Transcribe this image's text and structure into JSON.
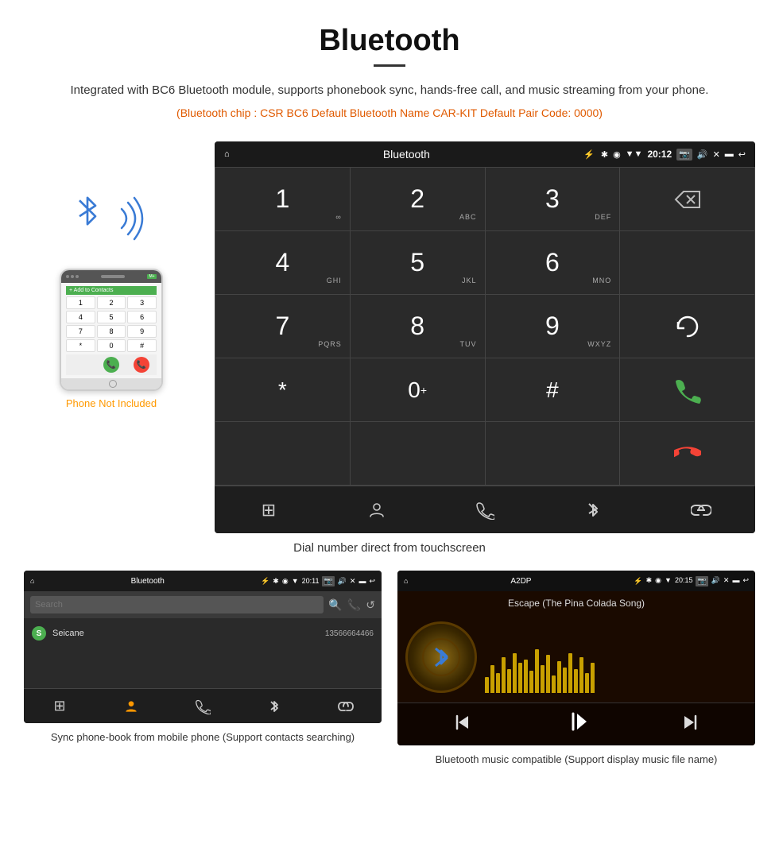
{
  "header": {
    "title": "Bluetooth",
    "description": "Integrated with BC6 Bluetooth module, supports phonebook sync, hands-free call, and music streaming from your phone.",
    "specs": "(Bluetooth chip : CSR BC6    Default Bluetooth Name CAR-KIT    Default Pair Code: 0000)"
  },
  "phone_label": "Phone Not Included",
  "dialer": {
    "title": "Bluetooth",
    "status": {
      "home_icon": "⌂",
      "usb_icon": "⚡",
      "bt_icon": "✱",
      "location_icon": "◉",
      "signal_icon": "▼",
      "time": "20:12",
      "camera_icon": "📷",
      "volume_icon": "🔊",
      "close_icon": "✕",
      "window_icon": "▬",
      "back_icon": "↩"
    },
    "keys": [
      {
        "label": "1",
        "sub": "∞"
      },
      {
        "label": "2",
        "sub": "ABC"
      },
      {
        "label": "3",
        "sub": "DEF"
      },
      {
        "label": "⌫",
        "type": "backspace"
      },
      {
        "label": "4",
        "sub": "GHI"
      },
      {
        "label": "5",
        "sub": "JKL"
      },
      {
        "label": "6",
        "sub": "MNO"
      },
      {
        "label": "",
        "type": "empty"
      },
      {
        "label": "7",
        "sub": "PQRS"
      },
      {
        "label": "8",
        "sub": "TUV"
      },
      {
        "label": "9",
        "sub": "WXYZ"
      },
      {
        "label": "↺",
        "type": "refresh"
      },
      {
        "label": "*",
        "type": "star"
      },
      {
        "label": "0⁺",
        "type": "zero"
      },
      {
        "label": "#",
        "type": "hash"
      },
      {
        "label": "📞",
        "type": "call-green"
      },
      {
        "label": "📞",
        "type": "call-red"
      }
    ],
    "nav_items": [
      "⊞",
      "👤",
      "📞",
      "✱",
      "🔗"
    ],
    "caption": "Dial number direct from touchscreen"
  },
  "phonebook": {
    "title": "Bluetooth",
    "status_time": "20:11",
    "search_placeholder": "Search",
    "contacts": [
      {
        "letter": "S",
        "name": "Seicane",
        "phone": "13566664466"
      }
    ],
    "caption": "Sync phone-book from mobile phone\n(Support contacts searching)"
  },
  "music": {
    "title": "A2DP",
    "status_time": "20:15",
    "track_name": "Escape (The Pina Colada Song)",
    "eq_bars": [
      20,
      35,
      25,
      45,
      30,
      50,
      38,
      42,
      28,
      55,
      35,
      48,
      22,
      40,
      32,
      50,
      30,
      45,
      25,
      38
    ],
    "caption": "Bluetooth music compatible\n(Support display music file name)"
  }
}
